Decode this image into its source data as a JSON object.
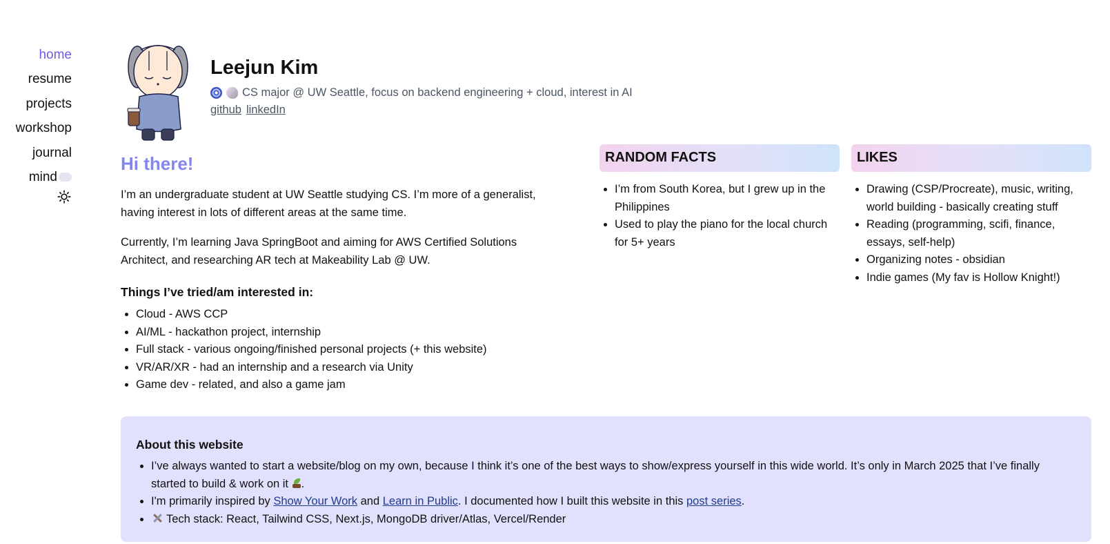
{
  "nav": {
    "items": [
      {
        "label": "home",
        "active": true
      },
      {
        "label": "resume",
        "active": false
      },
      {
        "label": "projects",
        "active": false
      },
      {
        "label": "workshop",
        "active": false
      },
      {
        "label": "journal",
        "active": false
      },
      {
        "label": "mind",
        "active": false
      }
    ],
    "theme_icon": "sun-icon"
  },
  "profile": {
    "name": "Leejun Kim",
    "tagline": "CS major @ UW Seattle, focus on backend engineering + cloud, interest in AI",
    "tagline_icons": [
      "swirl-emoji-icon",
      "shell-emoji-icon"
    ],
    "links": {
      "github": "github",
      "linkedin": "linkedIn"
    }
  },
  "intro": {
    "greeting": "Hi there!",
    "para1": "I’m an undergraduate student at UW Seattle studying CS. I’m more of a generalist, having interest in lots of different areas at the same time.",
    "para2": "Currently, I’m learning Java SpringBoot and aiming for AWS Certified Solutions Architect, and researching AR tech at Makeability Lab @ UW.",
    "tried_heading": "Things I’ve tried/am interested in:",
    "tried": [
      "Cloud - AWS CCP",
      "AI/ML - hackathon project, internship",
      "Full stack - various ongoing/finished personal projects (+ this website)",
      "VR/AR/XR - had an internship and a research via Unity",
      "Game dev - related, and also a game jam"
    ]
  },
  "random_facts": {
    "title": "RANDOM FACTS",
    "items": [
      "I’m from South Korea, but I grew up in the Philippines",
      "Used to play the piano for the local church for 5+ years"
    ]
  },
  "likes": {
    "title": "LIKES",
    "items": [
      "Drawing (CSP/Procreate), music, writing, world building - basically creating stuff",
      "Reading (programming, scifi, finance, essays, self-help)",
      "Organizing notes - obsidian",
      "Indie games (My fav is Hollow Knight!)"
    ]
  },
  "about": {
    "title": "About this website",
    "item1": "I’ve always wanted to start a website/blog on my own, because I think it’s one of the best ways to show/express yourself in this wide world. It’s only in March 2025 that I’ve finally started to build & work on it",
    "item1_end": ".",
    "item2_pre": "I'm primarily inspired by ",
    "item2_link1": "Show Your Work",
    "item2_mid1": " and ",
    "item2_link2": "Learn in Public",
    "item2_mid2": ". I documented how I built this website in this ",
    "item2_link3": "post series",
    "item2_end": ".",
    "item3": "Tech stack: React, Tailwind CSS, Next.js, MongoDB driver/Atlas, Vercel/Render"
  },
  "colors": {
    "accent": "#6d5ce7",
    "greeting": "#8386f0",
    "about_bg": "#e2e1fd",
    "card_gradient": [
      "#f3d3ee",
      "#e2e0f8",
      "#cfe3fb"
    ]
  }
}
